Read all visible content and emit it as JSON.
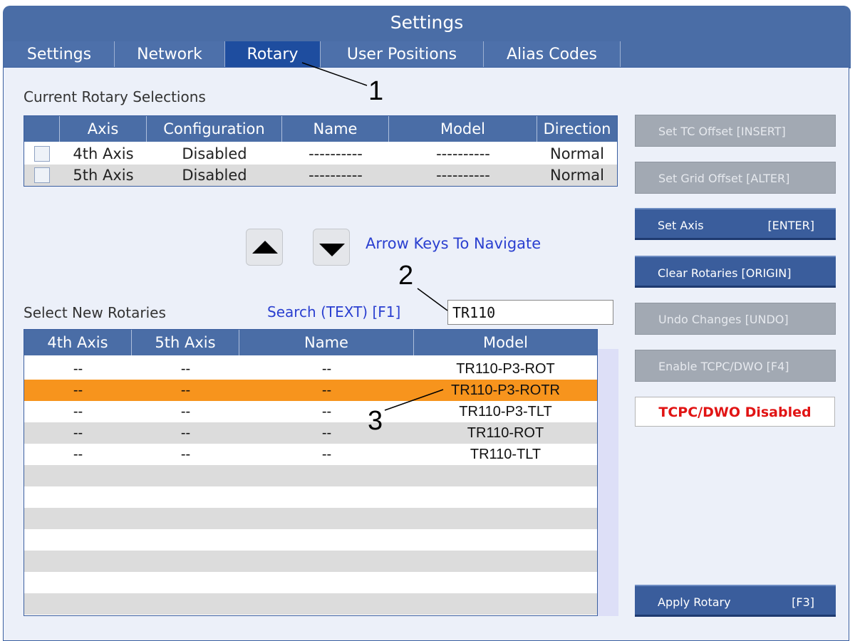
{
  "window": {
    "title": "Settings"
  },
  "tabs": [
    {
      "label": "Settings"
    },
    {
      "label": "Network"
    },
    {
      "label": "Rotary"
    },
    {
      "label": "User Positions"
    },
    {
      "label": "Alias Codes"
    }
  ],
  "current_rotary": {
    "label": "Current Rotary Selections",
    "columns": [
      "Axis",
      "Configuration",
      "Name",
      "Model",
      "Direction"
    ],
    "rows": [
      {
        "axis": "4th Axis",
        "configuration": "Disabled",
        "name": "----------",
        "model": "----------",
        "direction": "Normal"
      },
      {
        "axis": "5th Axis",
        "configuration": "Disabled",
        "name": "----------",
        "model": "----------",
        "direction": "Normal"
      }
    ]
  },
  "navigation": {
    "hint": "Arrow Keys To Navigate",
    "up_icon": "triangle-up-icon",
    "down_icon": "triangle-down-icon"
  },
  "new_rotary": {
    "label": "Select New Rotaries",
    "search_label": "Search (TEXT) [F1]",
    "search_value": "TR110",
    "columns": [
      "4th Axis",
      "5th Axis",
      "Name",
      "Model"
    ],
    "rows": [
      {
        "axis4": "--",
        "axis5": "--",
        "name": "--",
        "model": "TR110-P3-ROT"
      },
      {
        "axis4": "--",
        "axis5": "--",
        "name": "--",
        "model": "TR110-P3-ROTR"
      },
      {
        "axis4": "--",
        "axis5": "--",
        "name": "--",
        "model": "TR110-P3-TLT"
      },
      {
        "axis4": "--",
        "axis5": "--",
        "name": "--",
        "model": "TR110-ROT"
      },
      {
        "axis4": "--",
        "axis5": "--",
        "name": "--",
        "model": "TR110-TLT"
      }
    ],
    "selected_row_color": "#f7941d"
  },
  "side_buttons": [
    {
      "label": "Set TC Offset [INSERT]",
      "key": "",
      "state": "disabled"
    },
    {
      "label": "Set Grid Offset [ALTER]",
      "key": "",
      "state": "disabled"
    },
    {
      "label": "Set Axis",
      "key": "[ENTER]",
      "state": "enabled"
    },
    {
      "label": "Clear Rotaries [ORIGIN]",
      "key": "",
      "state": "enabled"
    },
    {
      "label": "Undo Changes [UNDO]",
      "key": "",
      "state": "disabled"
    },
    {
      "label": "Enable TCPC/DWO [F4]",
      "key": "",
      "state": "disabled"
    }
  ],
  "tcpc_status": "TCPC/DWO Disabled",
  "apply_button": {
    "label": "Apply Rotary",
    "key": "[F3]"
  },
  "callouts": [
    "1",
    "2",
    "3"
  ],
  "colors": {
    "header_blue": "#4a6da6",
    "active_tab": "#1e4d9f",
    "hint_blue": "#2a3fd0",
    "status_red": "#e11414"
  }
}
